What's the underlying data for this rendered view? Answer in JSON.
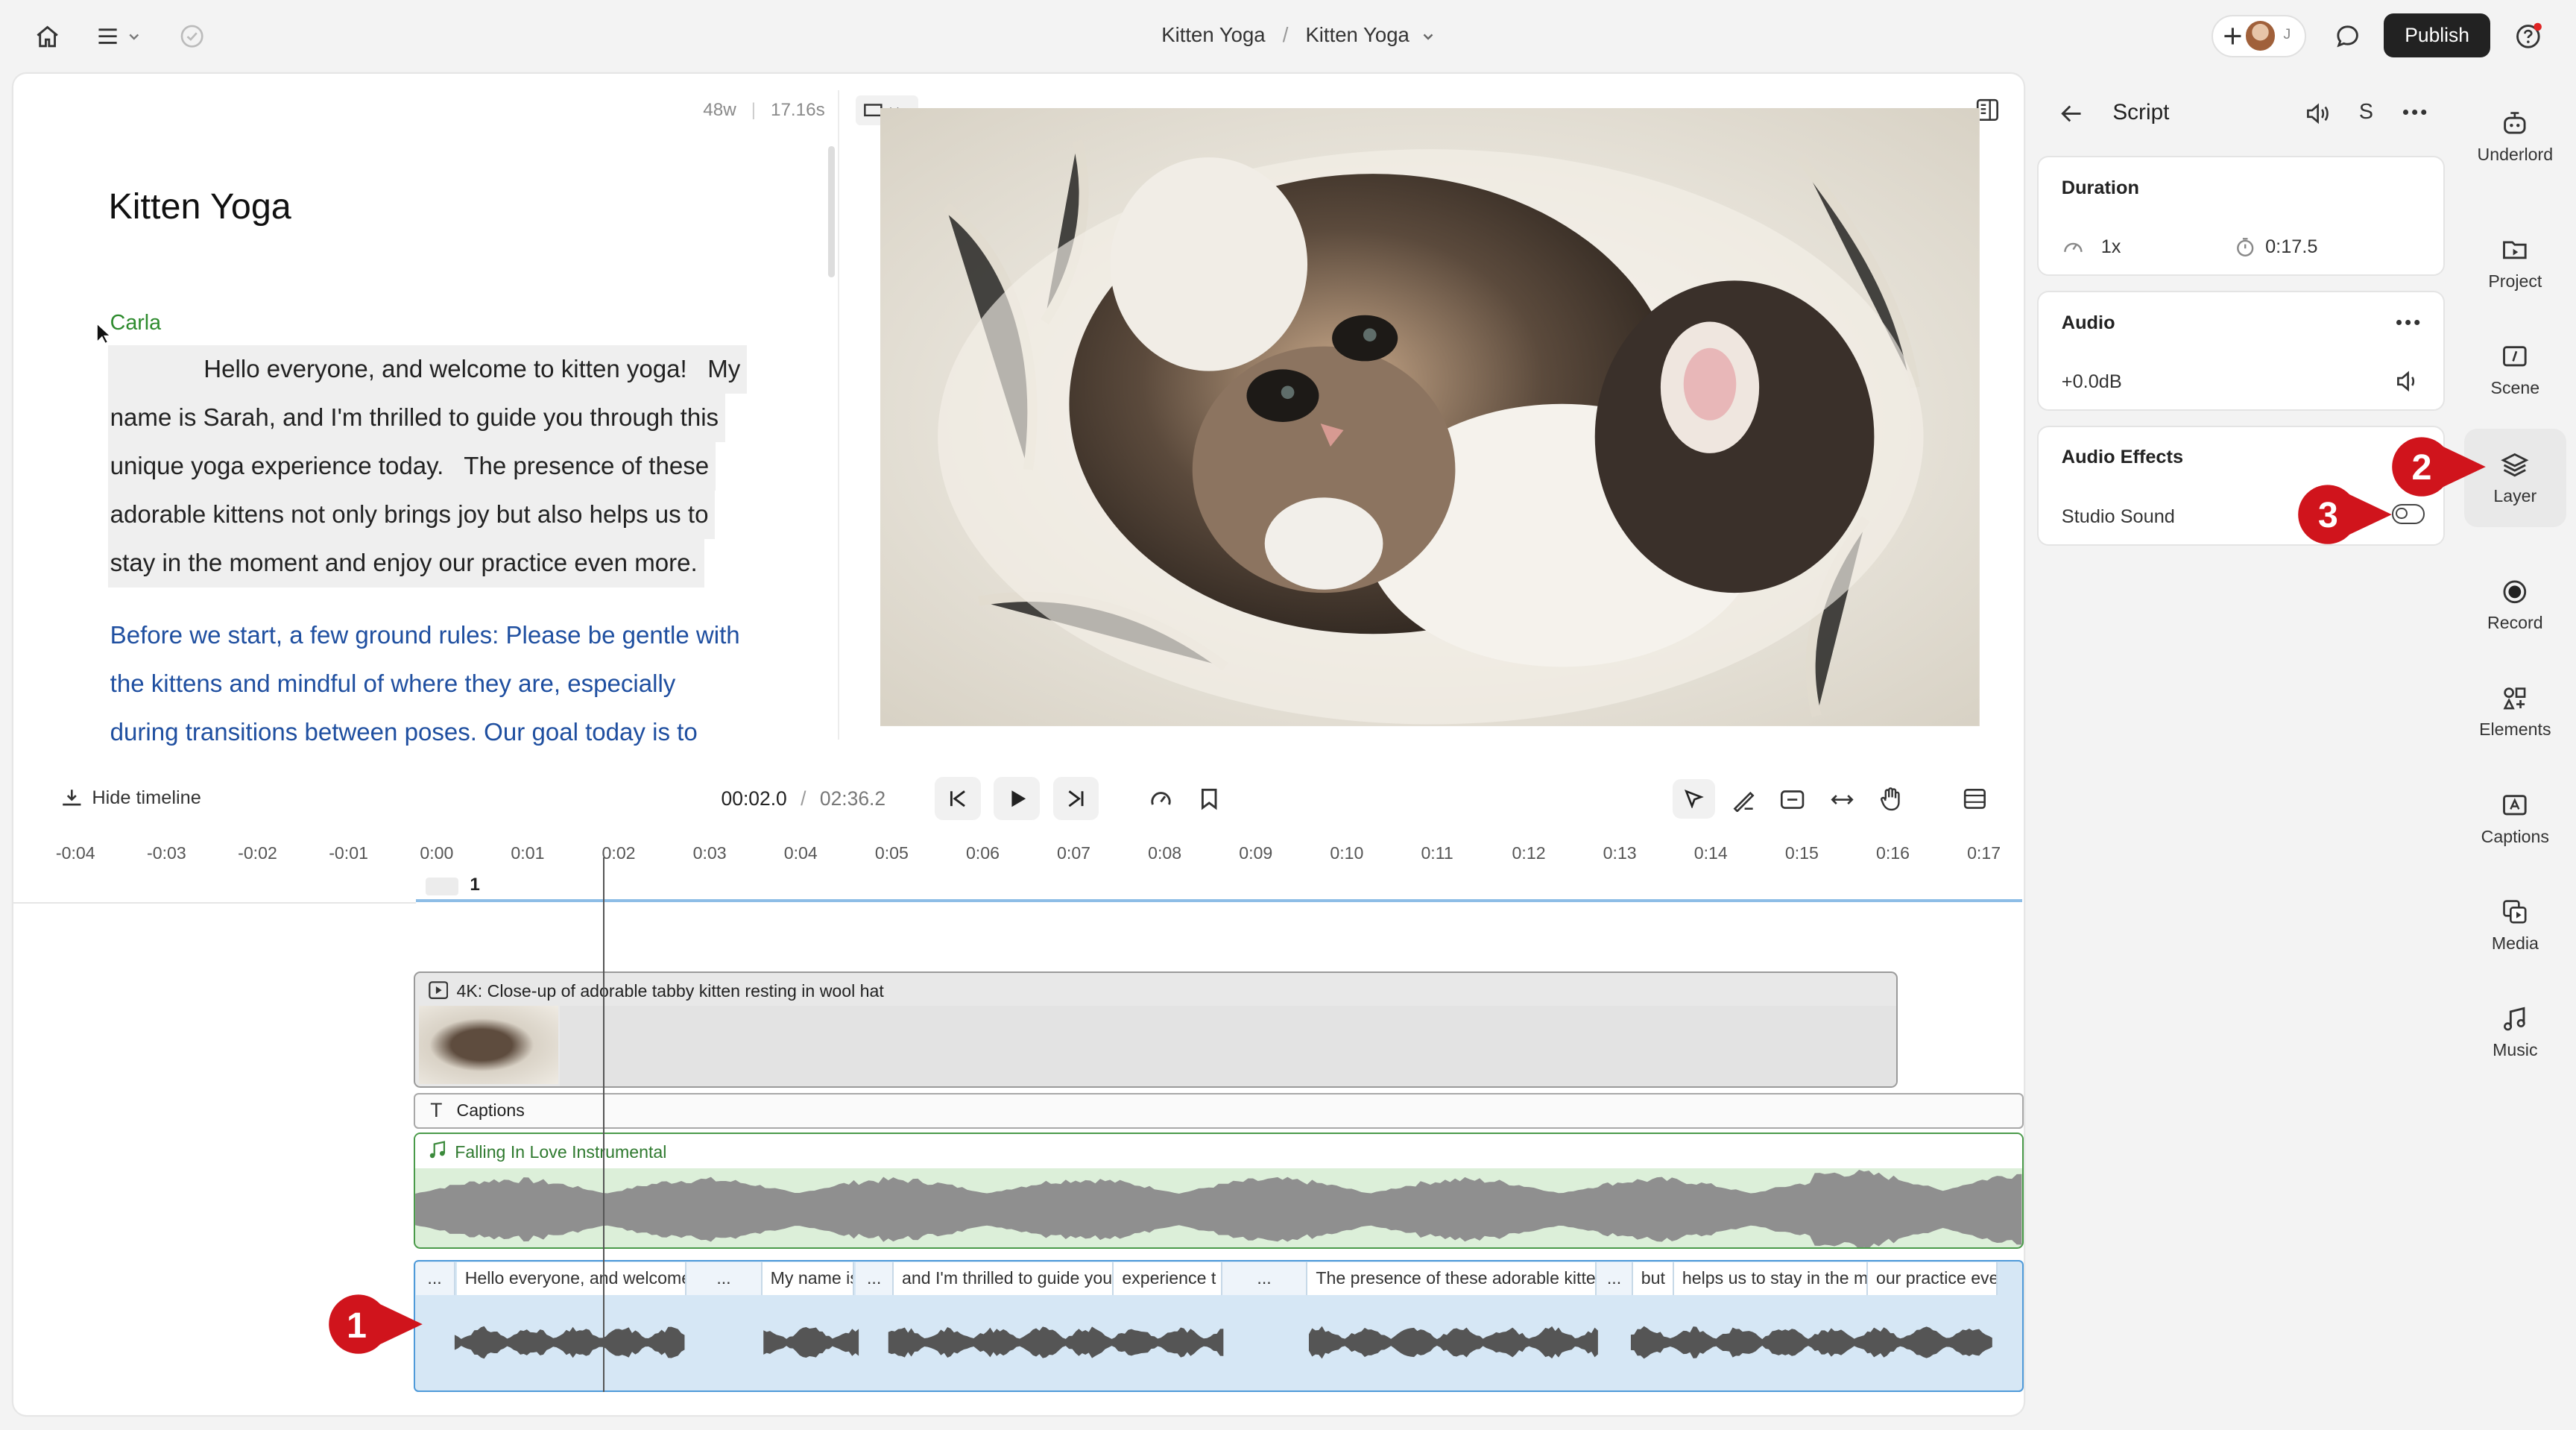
{
  "topbar": {
    "breadcrumb_project": "Kitten Yoga",
    "breadcrumb_sep": "/",
    "breadcrumb_doc": "Kitten Yoga",
    "avatar_initial": "J",
    "publish_label": "Publish"
  },
  "editor": {
    "word_count": "48w",
    "duration": "17.16s",
    "title": "Kitten Yoga",
    "speaker": "Carla",
    "paragraph1_lines": [
      "Hello everyone, and welcome to kitten yoga!   My",
      "name is Sarah, and I'm thrilled to guide you through this",
      "unique yoga experience today.   The presence of these",
      "adorable kittens not only brings joy but also helps us to",
      "stay in the moment and enjoy our practice even more."
    ],
    "paragraph2_lines": [
      "Before we start, a few ground rules: Please be gentle with",
      "the kittens and mindful of where they are, especially",
      "during transitions between poses. Our goal today is to"
    ]
  },
  "transport": {
    "hide_timeline_label": "Hide timeline",
    "current_time": "00:02.0",
    "time_sep": "/",
    "total_time": "02:36.2"
  },
  "ruler": {
    "ticks": [
      "-0:04",
      "-0:03",
      "-0:02",
      "-0:01",
      "0:00",
      "0:01",
      "0:02",
      "0:03",
      "0:04",
      "0:05",
      "0:06",
      "0:07",
      "0:08",
      "0:09",
      "0:10",
      "0:11",
      "0:12",
      "0:13",
      "0:14",
      "0:15",
      "0:16",
      "0:17"
    ],
    "scene_number": "1"
  },
  "tracks": {
    "video_clip_title": "4K: Close-up of adorable tabby kitten resting in wool hat",
    "captions_label": "Captions",
    "music_label": "Falling In Love Instrumental",
    "script_segments": [
      "...",
      "Hello everyone, and welcome",
      "...",
      "My name is",
      "...",
      "and I'm thrilled to guide you",
      "experience t",
      "...",
      "The presence of these adorable kittens",
      "...",
      "but",
      "helps us to stay in the moment",
      "our practice even"
    ]
  },
  "right_panel": {
    "header_title": "Script",
    "header_s": "S",
    "duration_heading": "Duration",
    "speed": "1x",
    "duration_value": "0:17.5",
    "audio_heading": "Audio",
    "gain": "+0.0dB",
    "effects_heading": "Audio Effects",
    "studio_sound_label": "Studio Sound",
    "studio_sound_on": false
  },
  "sidebar": {
    "items": [
      "Underlord",
      "Project",
      "Scene",
      "Layer",
      "Record",
      "Elements",
      "Captions",
      "Media",
      "Music"
    ]
  },
  "annotations": [
    "1",
    "2",
    "3"
  ],
  "colors": {
    "accent_blue": "#1f7ae0",
    "speaker_green": "#2e8b2e",
    "paragraph_blue": "#1f4fa0",
    "music_green": "#dcefd9",
    "script_blue": "#d6e7f5",
    "badge_red": "#d0141c"
  }
}
